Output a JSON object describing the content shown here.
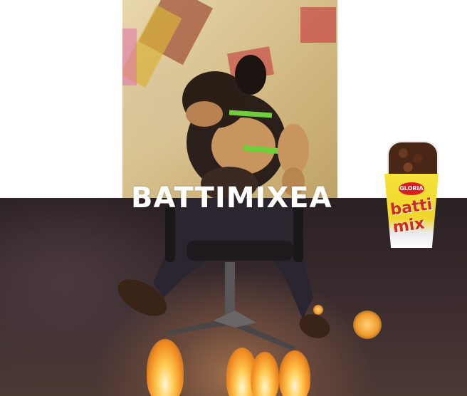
{
  "meme": {
    "caption": "BATTIMIXEA"
  },
  "product": {
    "brand": "GLORIA",
    "name": "batti mix"
  },
  "colors": {
    "caption_text": "#ffffff",
    "cup_yellow": "#f4e23a",
    "brand_red": "#e11b22"
  }
}
